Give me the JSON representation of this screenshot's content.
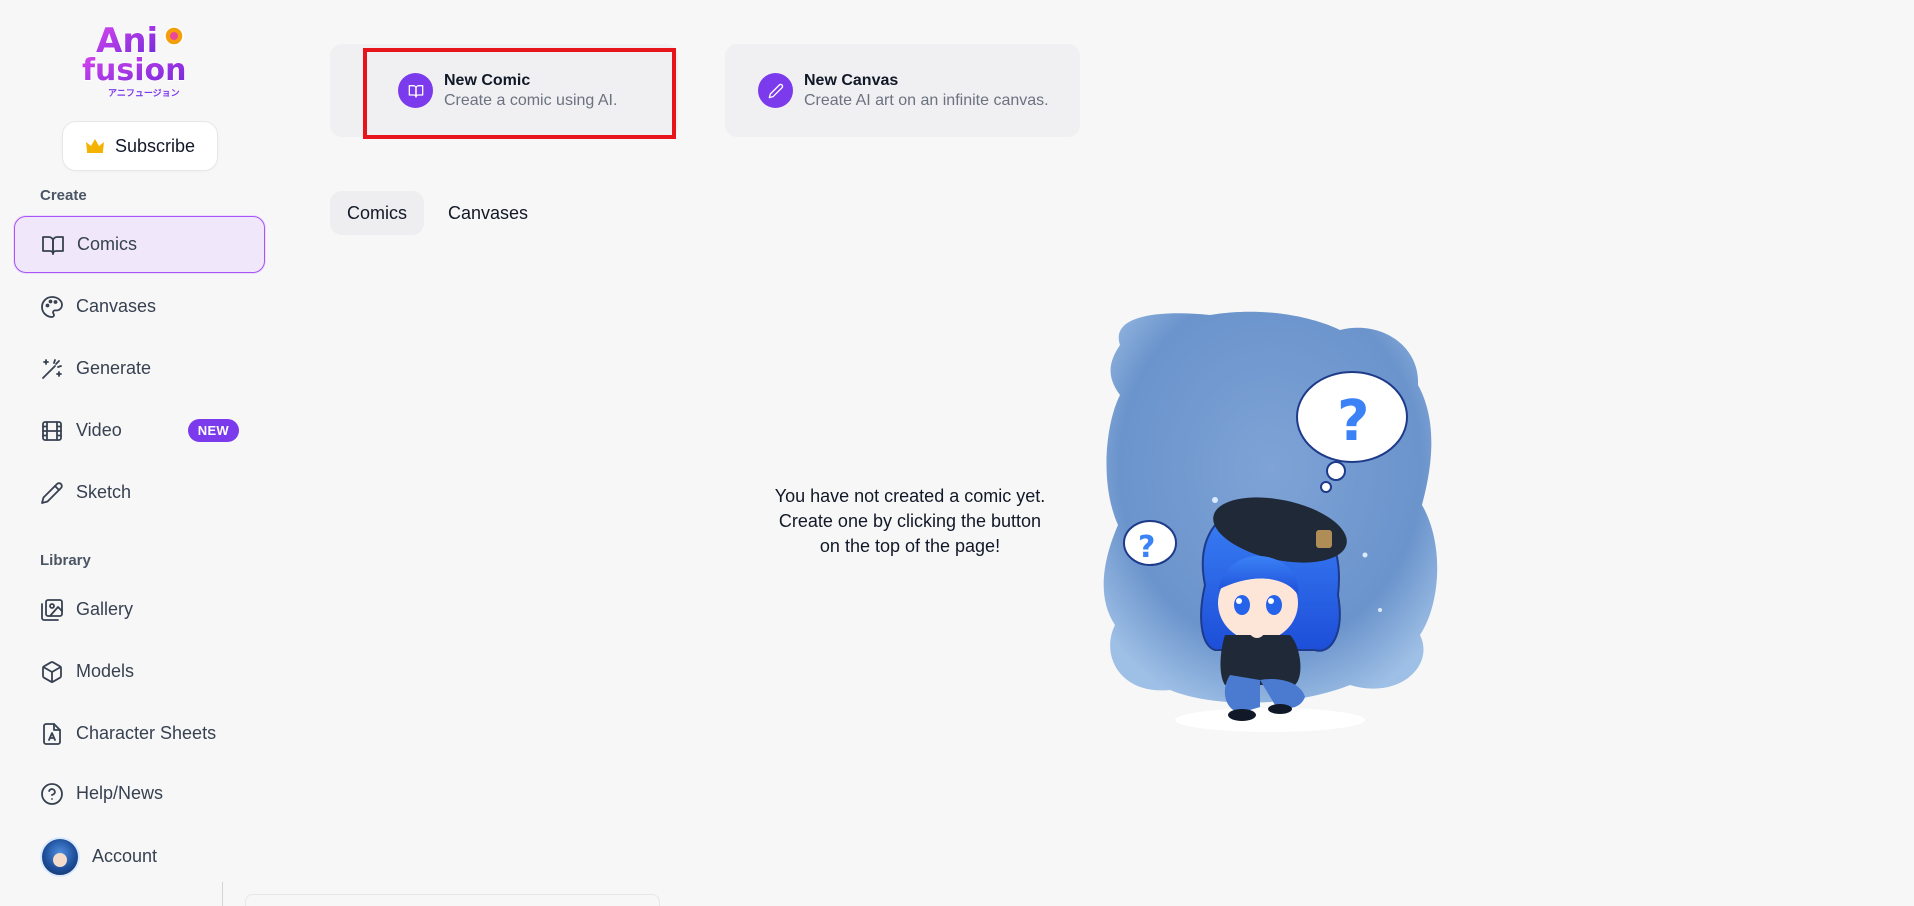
{
  "brand": {
    "logo_line1": "Ani",
    "logo_line2": "fusion",
    "logo_kana": "アニフュージョン"
  },
  "sidebar": {
    "subscribe_label": "Subscribe",
    "create_section": "Create",
    "library_section": "Library",
    "items": [
      {
        "label": "Comics",
        "icon": "book-open-icon"
      },
      {
        "label": "Canvases",
        "icon": "palette-icon"
      },
      {
        "label": "Generate",
        "icon": "magic-wand-icon"
      },
      {
        "label": "Video",
        "icon": "film-icon",
        "badge": "NEW"
      },
      {
        "label": "Sketch",
        "icon": "pencil-icon"
      },
      {
        "label": "Gallery",
        "icon": "image-gallery-icon"
      },
      {
        "label": "Models",
        "icon": "cube-icon"
      },
      {
        "label": "Character Sheets",
        "icon": "character-sheet-icon"
      },
      {
        "label": "Help/News",
        "icon": "help-circle-icon"
      },
      {
        "label": "Account",
        "icon": "avatar"
      }
    ]
  },
  "actions": {
    "new_comic": {
      "title": "New Comic",
      "description": "Create a comic using AI."
    },
    "new_canvas": {
      "title": "New Canvas",
      "description": "Create AI art on an infinite canvas."
    }
  },
  "tabs": [
    "Comics",
    "Canvases"
  ],
  "empty_state": {
    "message": "You have not created a comic yet. Create one by clicking the button on the top of the page!"
  },
  "colors": {
    "accent": "#7c3aed",
    "active_bg": "#f0e8fa",
    "highlight": "#e8141c",
    "background": "#f7f7f7"
  }
}
